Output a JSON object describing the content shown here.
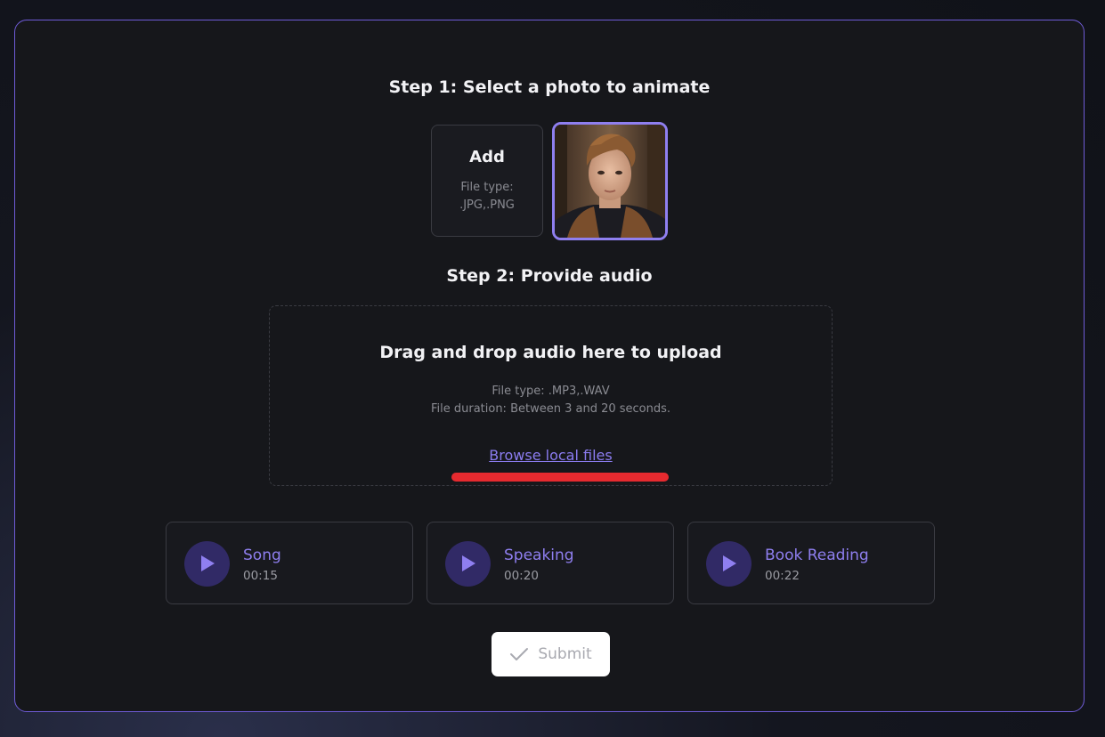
{
  "step1": {
    "title": "Step 1: Select a photo to animate"
  },
  "add_tile": {
    "title": "Add",
    "file_type": "File type: .JPG,.PNG"
  },
  "selected_photo": {
    "icon": "portrait-photo"
  },
  "step2": {
    "title": "Step 2: Provide audio"
  },
  "drop_zone": {
    "title": "Drag and drop audio here to upload",
    "file_type": "File type: .MP3,.WAV",
    "duration": "File duration: Between 3 and 20 seconds.",
    "browse_label": "Browse local files"
  },
  "audio_samples": [
    {
      "name": "Song",
      "duration": "00:15"
    },
    {
      "name": "Speaking",
      "duration": "00:20"
    },
    {
      "name": "Book Reading",
      "duration": "00:22"
    }
  ],
  "submit": {
    "label": "Submit",
    "icon": "check-icon"
  },
  "colors": {
    "accent": "#8f7ff0",
    "panel_border": "#6e5bd6",
    "panel_bg": "#16171b",
    "highlight_mark": "#e62a2f"
  }
}
